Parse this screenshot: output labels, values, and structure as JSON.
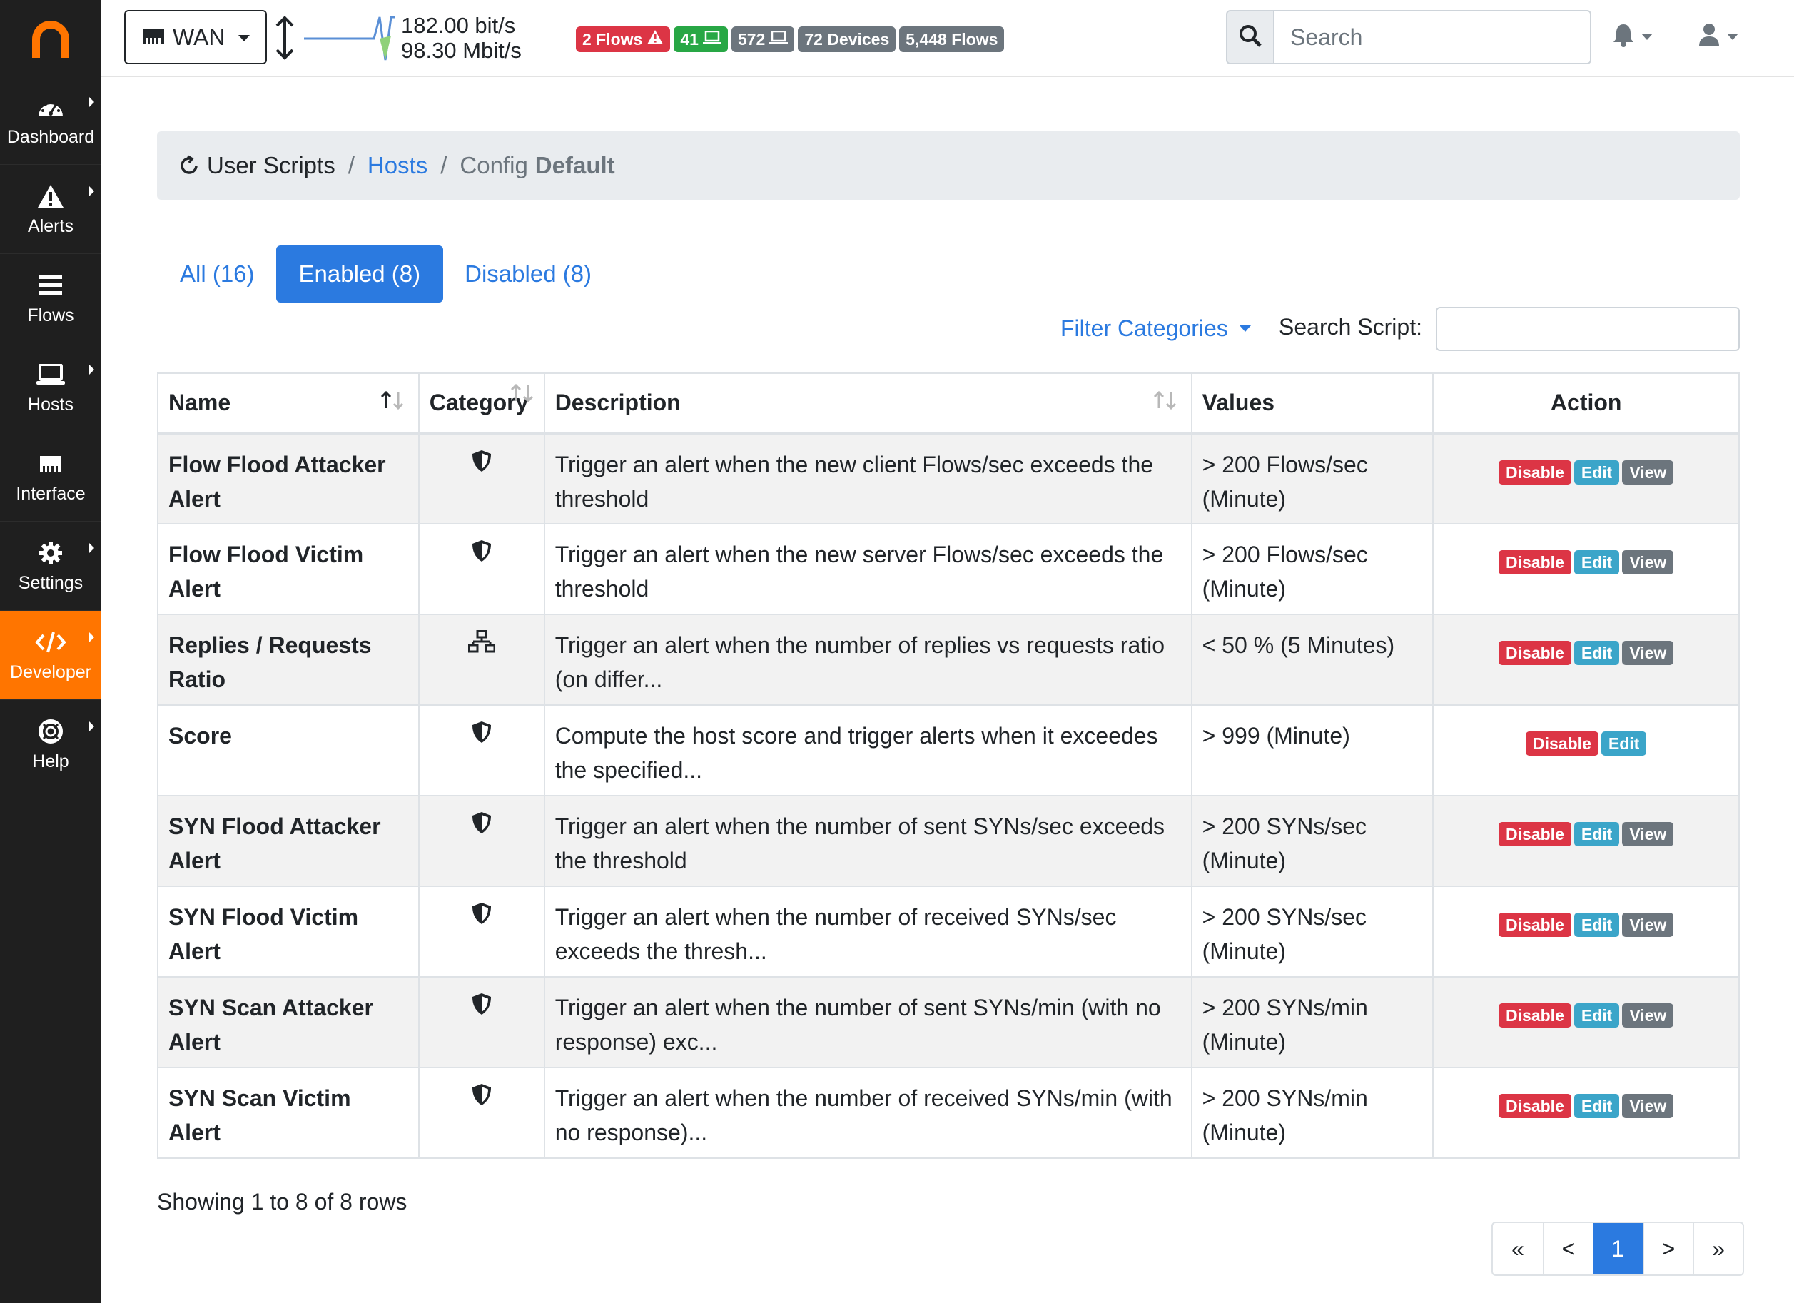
{
  "sidebar": {
    "items": [
      {
        "label": "Dashboard",
        "icon": "dashboard-icon",
        "active": false
      },
      {
        "label": "Alerts",
        "icon": "warning-icon",
        "active": false
      },
      {
        "label": "Flows",
        "icon": "flows-icon",
        "active": false
      },
      {
        "label": "Hosts",
        "icon": "laptop-icon",
        "active": false
      },
      {
        "label": "Interface",
        "icon": "ethernet-icon",
        "active": false
      },
      {
        "label": "Settings",
        "icon": "gear-icon",
        "active": false
      },
      {
        "label": "Developer",
        "icon": "code-icon",
        "active": true
      },
      {
        "label": "Help",
        "icon": "lifering-icon",
        "active": false
      }
    ]
  },
  "topbar": {
    "interface": "WAN",
    "traffic_upload": "182.00 bit/s",
    "traffic_download": "98.30 Mbit/s",
    "badges": {
      "flows_alert": "2 Flows",
      "hosts_local": "41",
      "hosts_remote": "572",
      "devices": "72 Devices",
      "flows": "5,448 Flows"
    },
    "search_placeholder": "Search"
  },
  "breadcrumb": {
    "root": "User Scripts",
    "hosts": "Hosts",
    "config_prefix": "Config",
    "config_name": "Default"
  },
  "tabs": {
    "all": "All (16)",
    "enabled": "Enabled (8)",
    "disabled": "Disabled (8)"
  },
  "filters": {
    "categories": "Filter Categories",
    "search_label": "Search Script:"
  },
  "table": {
    "headers": {
      "name": "Name",
      "category": "Category",
      "description": "Description",
      "values": "Values",
      "action": "Action"
    },
    "action_labels": {
      "disable": "Disable",
      "edit": "Edit",
      "view": "View"
    },
    "rows": [
      {
        "name": "Flow Flood Attacker Alert",
        "category": "shield-icon",
        "description": "Trigger an alert when the new client Flows/sec exceeds the threshold",
        "values": "> 200 Flows/sec (Minute)",
        "has_view": true
      },
      {
        "name": "Flow Flood Victim Alert",
        "category": "shield-icon",
        "description": "Trigger an alert when the new server Flows/sec exceeds the threshold",
        "values": "> 200 Flows/sec (Minute)",
        "has_view": true
      },
      {
        "name": "Replies / Requests Ratio",
        "category": "network-icon",
        "description": "Trigger an alert when the number of replies vs requests ratio (on differ...",
        "values": "< 50 % (5 Minutes)",
        "has_view": true
      },
      {
        "name": "Score",
        "category": "shield-icon",
        "description": "Compute the host score and trigger alerts when it exceedes the specified...",
        "values": "> 999 (Minute)",
        "has_view": false
      },
      {
        "name": "SYN Flood Attacker Alert",
        "category": "shield-icon",
        "description": "Trigger an alert when the number of sent SYNs/sec exceeds the threshold",
        "values": "> 200 SYNs/sec (Minute)",
        "has_view": true
      },
      {
        "name": "SYN Flood Victim Alert",
        "category": "shield-icon",
        "description": "Trigger an alert when the number of received SYNs/sec exceeds the thresh...",
        "values": "> 200 SYNs/sec (Minute)",
        "has_view": true
      },
      {
        "name": "SYN Scan Attacker Alert",
        "category": "shield-icon",
        "description": "Trigger an alert when the number of sent SYNs/min (with no response) exc...",
        "values": "> 200 SYNs/min (Minute)",
        "has_view": true
      },
      {
        "name": "SYN Scan Victim Alert",
        "category": "shield-icon",
        "description": "Trigger an alert when the number of received SYNs/min (with no response)...",
        "values": "> 200 SYNs/min (Minute)",
        "has_view": true
      }
    ]
  },
  "footer": {
    "showing": "Showing 1 to 8 of 8 rows",
    "pager": {
      "first": "«",
      "prev": "<",
      "current": "1",
      "next": ">",
      "last": "»"
    }
  },
  "colors": {
    "brand": "#ff7500",
    "primary": "#2b7ae0",
    "danger": "#dc3545",
    "success": "#28a745",
    "info": "#3ba5c9",
    "secondary": "#6c757d",
    "sidebar": "#1f1f1f"
  }
}
